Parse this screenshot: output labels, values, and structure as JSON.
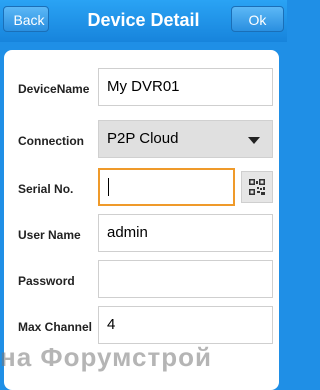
{
  "header": {
    "back_label": "Back",
    "title": "Device Detail",
    "ok_label": "Ok"
  },
  "form": {
    "device_name": {
      "label": "DeviceName",
      "value": "My DVR01"
    },
    "connection": {
      "label": "Connection",
      "value": "P2P Cloud"
    },
    "serial_no": {
      "label": "Serial No.",
      "value": ""
    },
    "user_name": {
      "label": "User Name",
      "value": "admin"
    },
    "password": {
      "label": "Password",
      "value": ""
    },
    "max_channel": {
      "label": "Max Channel",
      "value": "4"
    }
  },
  "watermark": "на Форумстрой",
  "colors": {
    "header_blue": "#1f8fe6",
    "focus_orange": "#ef9a2a"
  },
  "icons": {
    "qr_scan": "qr-code-icon"
  }
}
